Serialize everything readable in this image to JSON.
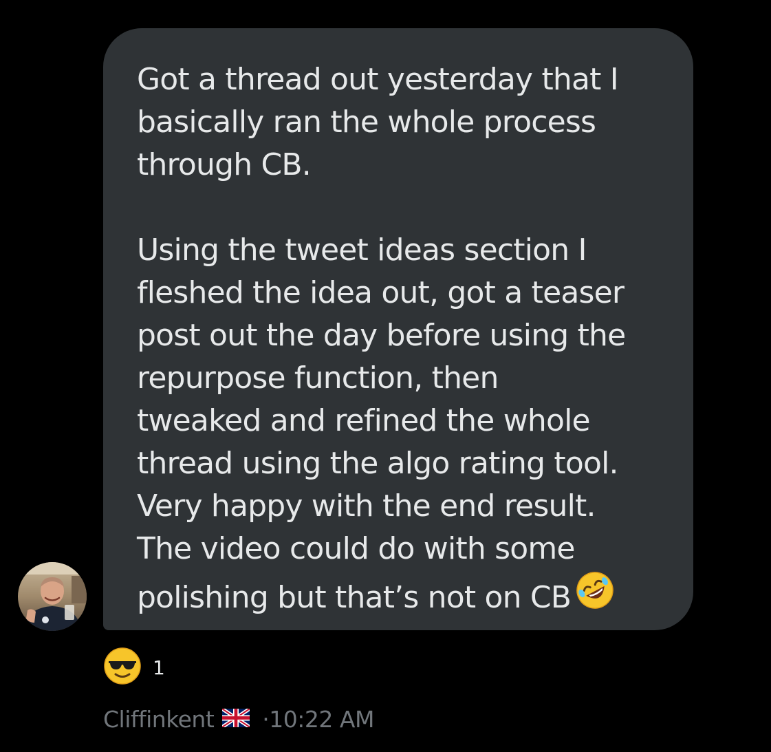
{
  "message": {
    "paragraph1": [
      "Got a thread out yesterday that I",
      "basically ran the whole process",
      "through CB."
    ],
    "paragraph2": [
      "Using the tweet ideas section I",
      "fleshed the idea out, got a teaser",
      "post out the day before using the",
      "repurpose function, then",
      "tweaked and refined the whole",
      "thread using the algo rating tool.",
      "Very happy with the end result.",
      "The video could do with some",
      "polishing but that’s not on CB"
    ],
    "trailing_emoji": "rolling-on-floor-laughing-emoji"
  },
  "reaction": {
    "emoji": "sunglasses-face-emoji",
    "count": "1"
  },
  "meta": {
    "username": "Cliffinkent",
    "flag": "uk-flag-icon",
    "time": "·10:22 AM"
  },
  "colors": {
    "background": "#000000",
    "bubble": "#2f3336",
    "text": "#e7e9ea",
    "meta_text": "#71767b"
  }
}
